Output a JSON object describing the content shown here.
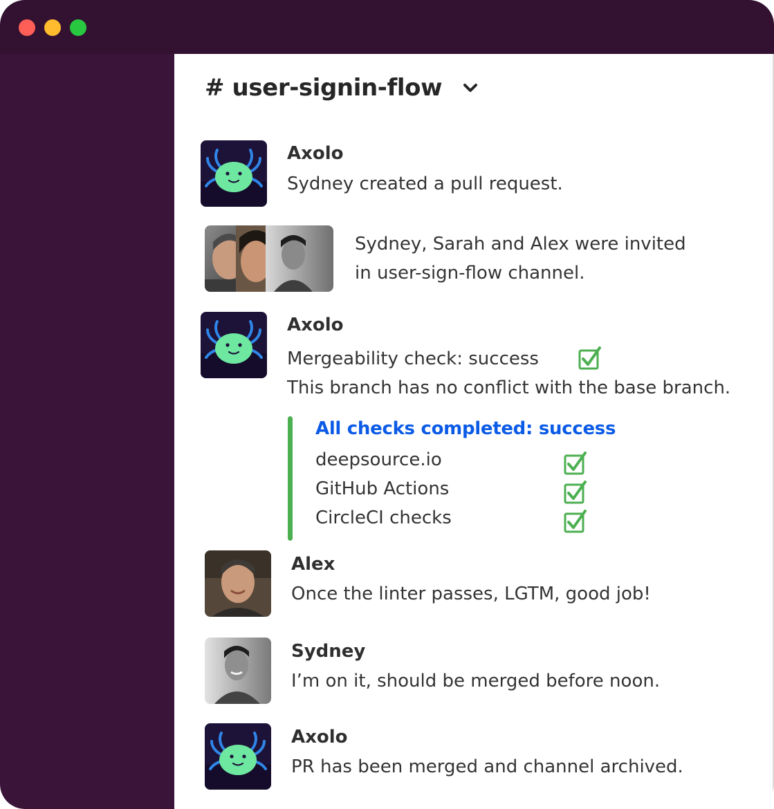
{
  "window": {
    "controls": [
      "close",
      "minimize",
      "maximize"
    ],
    "colors": {
      "titlebar": "#331231",
      "sidebar": "#3b1539",
      "accent_blue": "#0b5be6",
      "check_green": "#4caf50"
    }
  },
  "channel": {
    "name": "# user-signin-flow",
    "dropdown_icon": "chevron-down-icon"
  },
  "messages": [
    {
      "author": "Axolo",
      "avatar_icon": "axolotl-bot-icon",
      "lines": [
        "Sydney created a pull request."
      ]
    },
    {
      "author": "",
      "avatar_icon": "group-avatars",
      "lines": [
        "Sydney, Sarah and Alex were invited",
        "in user-sign-flow channel."
      ]
    },
    {
      "author": "Axolo",
      "avatar_icon": "axolotl-bot-icon",
      "lines": [
        "Mergeability check: success",
        "This branch has no conflict with the base branch."
      ],
      "status_icon": "checkbox-checked-icon",
      "checks": {
        "title": "All checks completed: success",
        "items": [
          {
            "label": "deepsource.io",
            "status": "success"
          },
          {
            "label": "GitHub Actions",
            "status": "success"
          },
          {
            "label": "CircleCI checks",
            "status": "success"
          }
        ]
      }
    },
    {
      "author": "Alex",
      "avatar_icon": "user-photo-alex",
      "lines": [
        "Once the linter passes, LGTM, good job!"
      ]
    },
    {
      "author": "Sydney",
      "avatar_icon": "user-photo-sydney",
      "lines": [
        "I’m on it, should be merged before noon."
      ]
    },
    {
      "author": "Axolo",
      "avatar_icon": "axolotl-bot-icon",
      "lines": [
        "PR has been merged and channel archived."
      ]
    }
  ]
}
